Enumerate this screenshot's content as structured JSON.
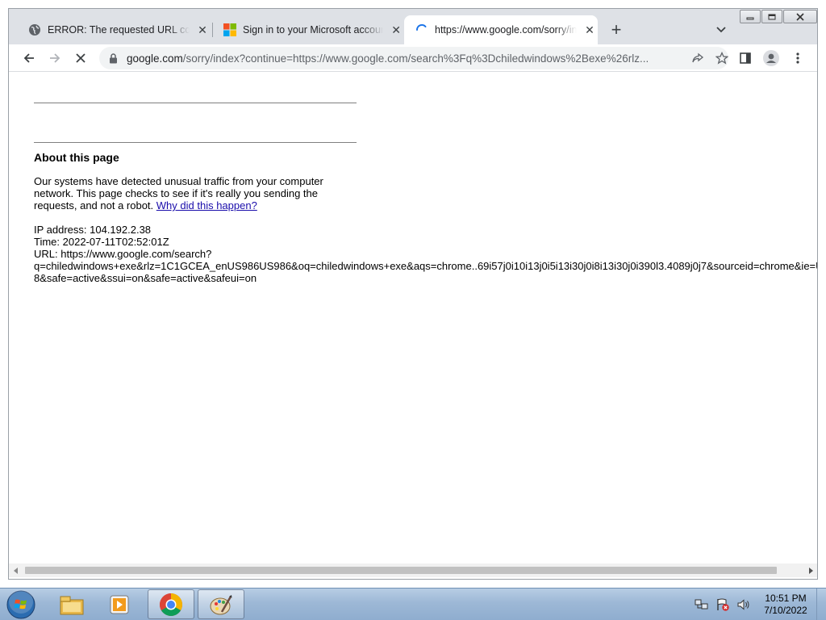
{
  "browser": {
    "tabs": [
      {
        "title": "ERROR: The requested URL could not be retrieved",
        "favicon": "globe-icon",
        "close": "✕"
      },
      {
        "title": "Sign in to your Microsoft account",
        "favicon": "microsoft-logo-icon",
        "close": "✕"
      },
      {
        "title": "https://www.google.com/sorry/index?continue=https://www.google.com/search",
        "favicon": "loading-spinner-icon",
        "close": "✕"
      }
    ],
    "new_tab": "+",
    "window_controls": [
      "minimize",
      "maximize",
      "close"
    ]
  },
  "toolbar": {
    "url_host": "google.com",
    "url_path": "/sorry/index?continue=https://www.google.com/search%3Fq%3Dchiledwindows%2Bexe%26rlz..."
  },
  "page": {
    "about_heading": "About this page",
    "paragraph_text": "Our systems have detected unusual traffic from your computer network. This page checks to see if it's really you sending the requests, and not a robot.",
    "why_link": "Why did this happen?",
    "ip_line": "IP address: 104.192.2.38",
    "time_line": "Time: 2022-07-11T02:52:01Z",
    "url_line_1": "URL: https://www.google.com/search?",
    "url_line_2": "q=chiledwindows+exe&rlz=1C1GCEA_enUS986US986&oq=chiledwindows+exe&aqs=chrome..69i57j0i10i13j0i5i13i30j0i8i13i30j0i390l3.4089j0j7&sourceid=chrome&ie=UTF-",
    "url_line_3": "8&safe=active&ssui=on&safe=active&safeui=on"
  },
  "taskbar": {
    "items": [
      "start-orb",
      "file-explorer",
      "media-player",
      "google-chrome",
      "paint"
    ],
    "active_item": "google-chrome",
    "clock_time": "10:51 PM",
    "clock_date": "7/10/2022"
  },
  "colors": {
    "tab_strip": "#dee1e6",
    "link": "#1a0dab",
    "taskbar": "#9db8d6"
  }
}
